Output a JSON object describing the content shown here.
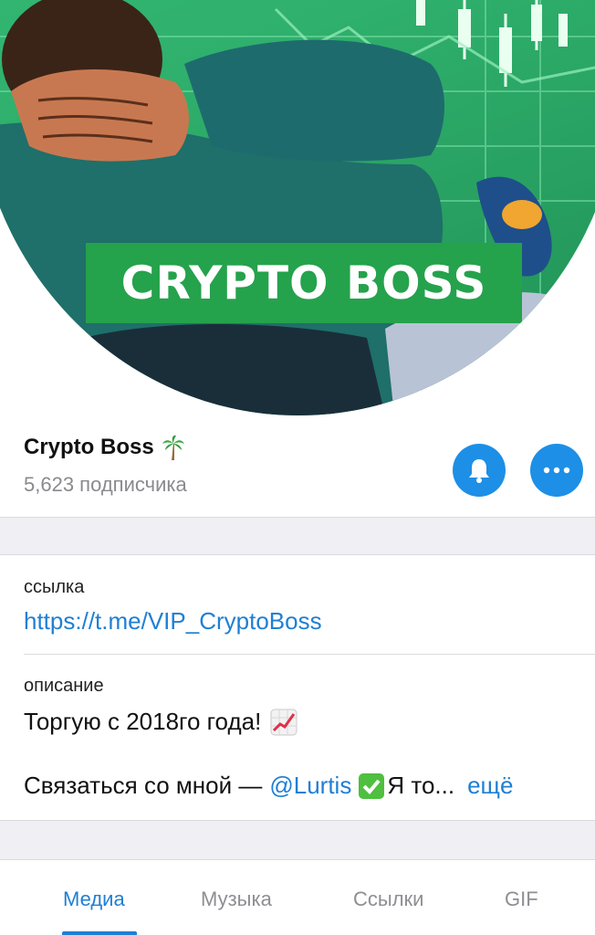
{
  "avatar": {
    "banner_text": "CRYPTO BOSS",
    "colors": {
      "background": "#2fb06c",
      "banner": "#25a24c"
    }
  },
  "channel": {
    "name": "Crypto Boss",
    "name_emoji": "palm-tree-icon",
    "subscribers": "5,623 подписчика"
  },
  "actions": {
    "bell_icon": "bell-icon",
    "more_icon": "more-dots-icon",
    "accent": "#1d8fe6"
  },
  "info": {
    "link_label": "ссылка",
    "link_value": "https://t.me/VIP_CryptoBoss",
    "description_label": "описание",
    "description_line1": "Торгую с 2018го года!",
    "description_line1_emoji": "chart-increasing-icon",
    "description_line2_prefix": "Связаться со мной —",
    "description_mention": "@Lurtis",
    "description_check_emoji": "check-mark-icon",
    "description_truncated": "Я то...",
    "more_label": "ещё"
  },
  "tabs": {
    "items": [
      {
        "label": "Медиа",
        "active": true
      },
      {
        "label": "Музыка",
        "active": false
      },
      {
        "label": "Ссылки",
        "active": false
      },
      {
        "label": "GIF",
        "active": false
      }
    ]
  }
}
